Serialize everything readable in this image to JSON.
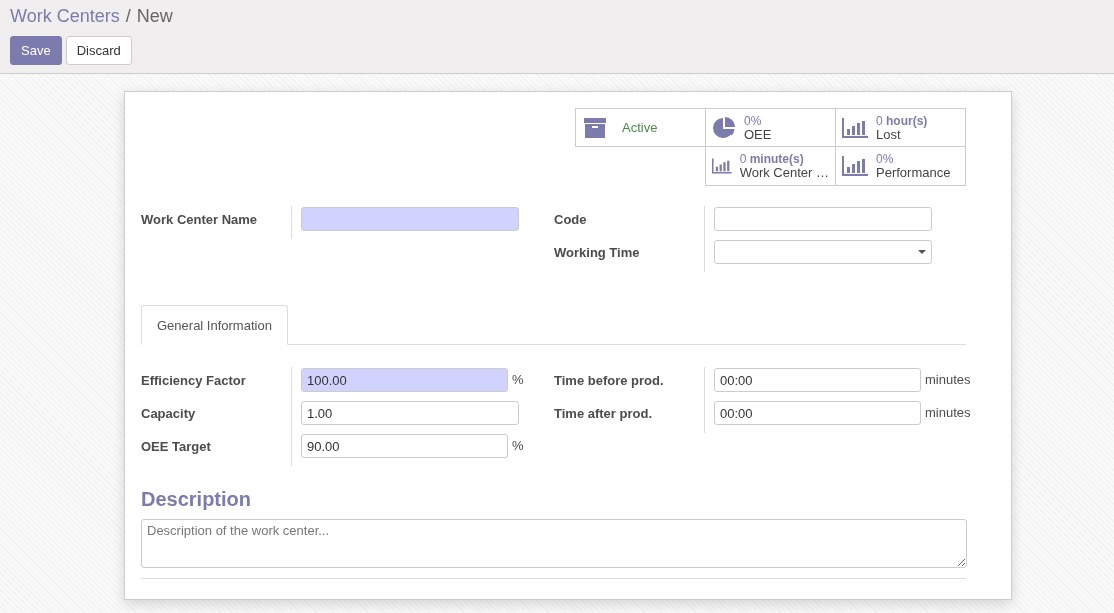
{
  "breadcrumb": {
    "items": [
      {
        "label": "Work Centers",
        "kind": "link"
      },
      {
        "label": "New",
        "kind": "current"
      }
    ],
    "separator": "/"
  },
  "buttons": [
    {
      "label": "Save",
      "kind": "primary"
    },
    {
      "label": "Discard",
      "kind": "secondary"
    }
  ],
  "smart_buttons": [
    [
      {
        "kind": "toggle",
        "label": "Active"
      },
      {
        "kind": "ratio",
        "value": "0%",
        "label": "OEE"
      },
      {
        "kind": "stat",
        "value": "0",
        "unit": "hour(s)",
        "label": "Lost"
      }
    ],
    [
      {
        "kind": "stat",
        "value": "0",
        "unit": "minute(s)",
        "label": "Work Center …"
      },
      {
        "kind": "stat",
        "value": "0%",
        "label": "Performance"
      }
    ]
  ],
  "main_fields": [
    [
      {
        "label": "Work Center Name",
        "kind": "text",
        "highlighted": true
      }
    ],
    [
      {
        "label": "Code",
        "kind": "text",
        "highlighted": false
      },
      {
        "label": "Working Time",
        "kind": "select",
        "highlighted": false
      }
    ]
  ],
  "tabs": [
    {
      "label": "General Information",
      "selected": true
    }
  ],
  "tab_fields": [
    [
      {
        "label": "Efficiency Factor",
        "kind": "text",
        "value": "100.00",
        "suffix": "%",
        "highlighted": true
      },
      {
        "label": "Capacity",
        "kind": "text",
        "value": "1.00",
        "highlighted": false
      },
      {
        "label": "OEE Target",
        "kind": "text",
        "value": "90.00",
        "suffix": "%",
        "highlighted": false
      }
    ],
    [
      {
        "label": "Time before prod.",
        "kind": "text",
        "value": "00:00",
        "suffix": "minutes",
        "highlighted": false
      },
      {
        "label": "Time after prod.",
        "kind": "text",
        "value": "00:00",
        "suffix": "minutes",
        "highlighted": false
      }
    ]
  ],
  "description": {
    "title": "Description",
    "placeholder": "Description of the work center..."
  }
}
